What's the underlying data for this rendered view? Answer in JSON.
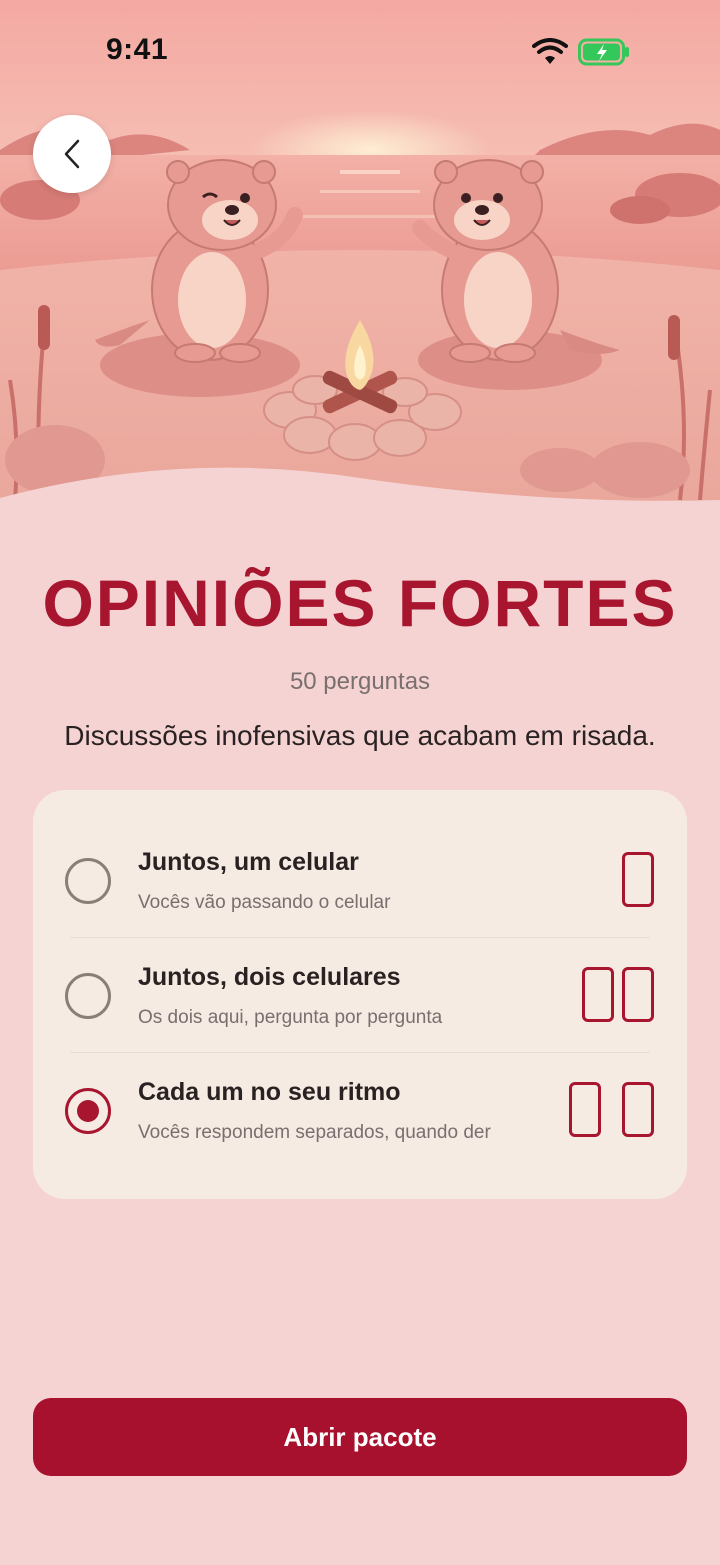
{
  "status_bar": {
    "time": "9:41"
  },
  "pack": {
    "title": "OPINIÕES FORTES",
    "question_count": "50 perguntas",
    "description": "Discussões inofensivas que acabam em risada."
  },
  "modes": [
    {
      "title": "Juntos, um celular",
      "subtitle": "Vocês vão passando o celular",
      "selected": false,
      "icon": "single-phone-icon"
    },
    {
      "title": "Juntos, dois celulares",
      "subtitle": "Os dois aqui, pergunta por pergunta",
      "selected": false,
      "icon": "two-phones-together-icon"
    },
    {
      "title": "Cada um no seu ritmo",
      "subtitle": "Vocês respondem separados, quando der",
      "selected": true,
      "icon": "two-phones-apart-icon"
    }
  ],
  "cta": {
    "label": "Abrir pacote"
  },
  "colors": {
    "accent": "#a8152f",
    "background": "#f5d3d3",
    "card": "#f5ebe3",
    "battery": "#34c759"
  }
}
